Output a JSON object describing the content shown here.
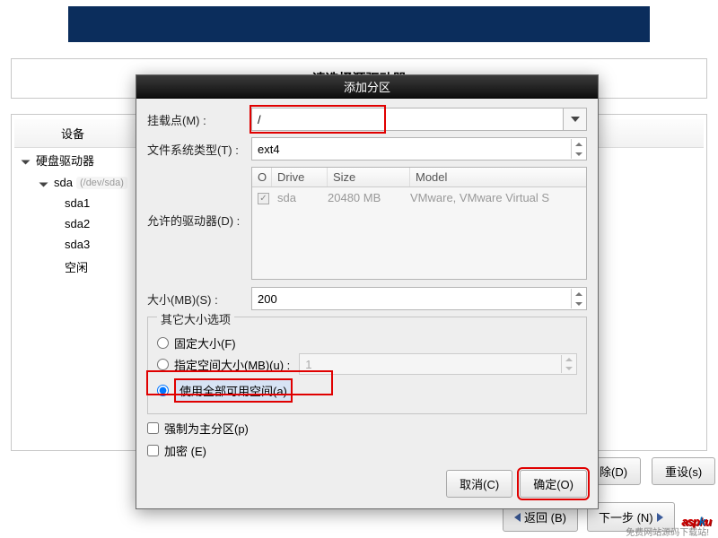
{
  "background": {
    "main_title": "请选择源驱动器",
    "tree_header": "设备",
    "tree": {
      "root": "硬盘驱动器",
      "disk": "sda",
      "disk_path": "(/dev/sda)",
      "parts": [
        "sda1",
        "sda2",
        "sda3",
        "空闲"
      ]
    },
    "buttons": {
      "delete": "删除(D)",
      "reset": "重设(s)"
    },
    "nav": {
      "back": "返回 (B)",
      "next": "下一步 (N)"
    }
  },
  "modal": {
    "title": "添加分区",
    "mount_label": "挂载点(M) :",
    "mount_value": "/",
    "fs_label": "文件系统类型(T) :",
    "fs_value": "ext4",
    "allowed_label": "允许的驱动器(D) :",
    "drive_cols": {
      "c1": "O",
      "c2": "Drive",
      "c3": "Size",
      "c4": "Model"
    },
    "drive_row": {
      "name": "sda",
      "size": "20480 MB",
      "model": "VMware, VMware Virtual S"
    },
    "size_label": "大小(MB)(S) :",
    "size_value": "200",
    "other_size_label": "其它大小选项",
    "radio_fixed": "固定大小(F)",
    "radio_upto": "指定空间大小(MB)(u) :",
    "radio_upto_disabled_value": "1",
    "radio_all": "使用全部可用空间(a)",
    "check_primary": "强制为主分区(p)",
    "check_encrypt": "加密 (E)",
    "cancel": "取消(C)",
    "ok": "确定(O)"
  },
  "watermark": {
    "text_a": "asp",
    "text_k": "k",
    "text_u": "u",
    "sub": "免费网站源码下载站!"
  }
}
